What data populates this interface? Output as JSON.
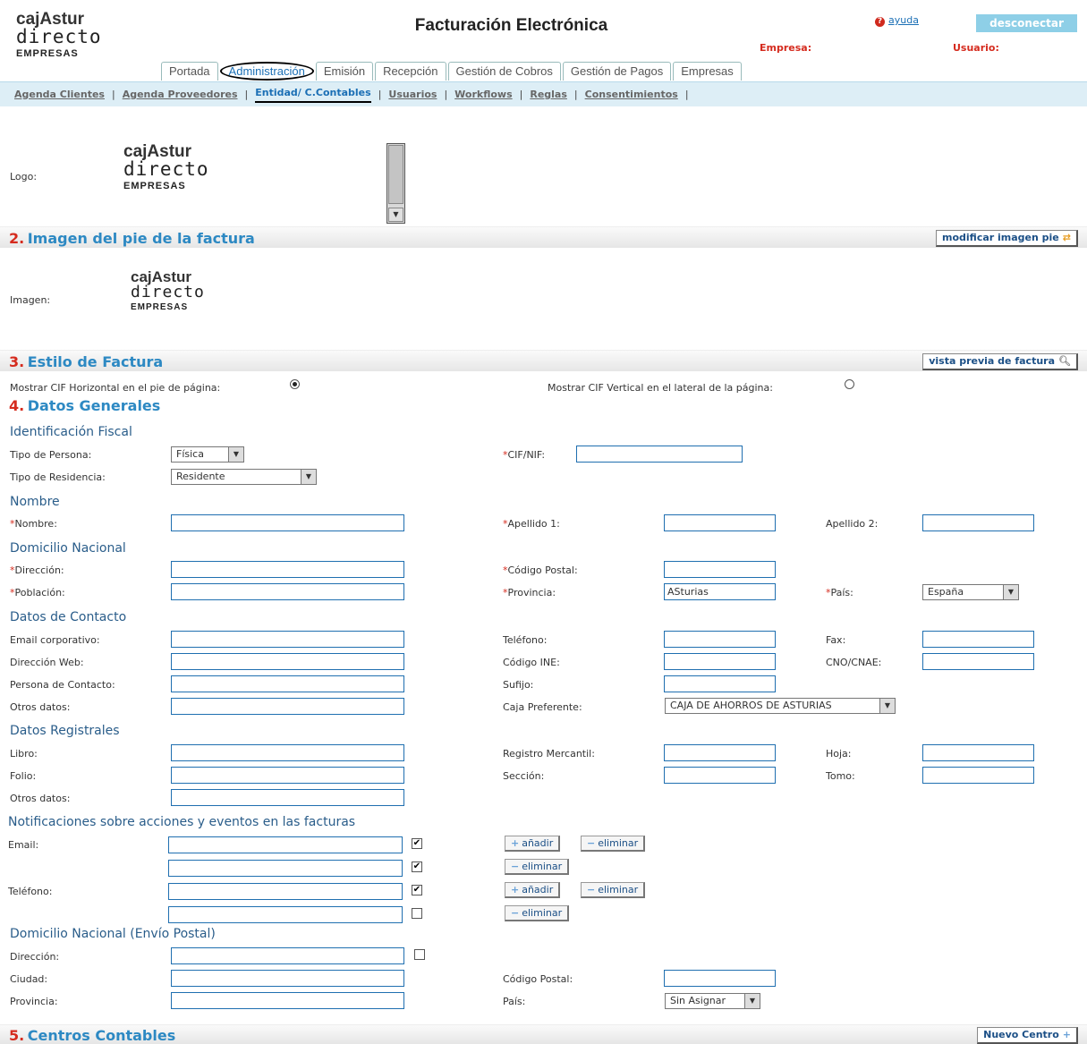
{
  "brand": {
    "line1": "cajAstur",
    "line2": "directo",
    "line3": "EMPRESAS"
  },
  "header": {
    "title": "Facturación Electrónica",
    "help": "ayuda",
    "logout": "desconectar",
    "empresa_label": "Empresa:",
    "usuario_label": "Usuario:"
  },
  "tabs": [
    "Portada",
    "Administración",
    "Emisión",
    "Recepción",
    "Gestión de Cobros",
    "Gestión de Pagos",
    "Empresas"
  ],
  "subnav": [
    "Agenda Clientes",
    "Agenda Proveedores",
    "Entidad/ C.Contables",
    "Usuarios",
    "Workflows",
    "Reglas",
    "Consentimientos"
  ],
  "logo_label": "Logo:",
  "s2": {
    "num": "2.",
    "title": "Imagen del pie de la factura",
    "button": "modificar imagen pie",
    "image_label": "Imagen:"
  },
  "s3": {
    "num": "3.",
    "title": "Estilo de Factura",
    "button": "vista previa de factura",
    "opt_h": "Mostrar CIF Horizontal en el pie de página:",
    "opt_v": "Mostrar CIF Vertical en el lateral de la página:"
  },
  "s4": {
    "num": "4.",
    "title": "Datos Generales"
  },
  "fiscal": {
    "title": "Identificación Fiscal",
    "tipo_persona": "Tipo de Persona:",
    "tipo_persona_val": "Física",
    "tipo_res": "Tipo de Residencia:",
    "tipo_res_val": "Residente",
    "cif": "CIF/NIF:"
  },
  "nombre": {
    "title": "Nombre",
    "nombre": "Nombre:",
    "ap1": "Apellido 1:",
    "ap2": "Apellido 2:"
  },
  "domicilio": {
    "title": "Domicilio Nacional",
    "direccion": "Dirección:",
    "cp": "Código Postal:",
    "poblacion": "Población:",
    "provincia": "Provincia:",
    "provincia_val": "ASturias",
    "pais": "País:",
    "pais_val": "España"
  },
  "contacto": {
    "title": "Datos de Contacto",
    "email": "Email corporativo:",
    "telefono": "Teléfono:",
    "fax": "Fax:",
    "web": "Dirección Web:",
    "ine": "Código INE:",
    "cnae": "CNO/CNAE:",
    "persona": "Persona de Contacto:",
    "sufijo": "Sufijo:",
    "otros": "Otros datos:",
    "caja": "Caja Preferente:",
    "caja_val": "CAJA DE AHORROS DE ASTURIAS"
  },
  "registrales": {
    "title": "Datos Registrales",
    "libro": "Libro:",
    "registro": "Registro Mercantil:",
    "hoja": "Hoja:",
    "folio": "Folio:",
    "seccion": "Sección:",
    "tomo": "Tomo:",
    "otros": "Otros datos:"
  },
  "notif": {
    "title": "Notificaciones sobre acciones y eventos en las facturas",
    "email": "Email:",
    "telefono": "Teléfono:",
    "add": "añadir",
    "del": "eliminar"
  },
  "postal": {
    "title": "Domicilio Nacional (Envío Postal)",
    "direccion": "Dirección:",
    "ciudad": "Ciudad:",
    "cp": "Código Postal:",
    "provincia": "Provincia:",
    "pais": "País:",
    "pais_val": "Sin Asignar"
  },
  "s5": {
    "num": "5.",
    "title": "Centros Contables",
    "button": "Nuevo Centro"
  }
}
